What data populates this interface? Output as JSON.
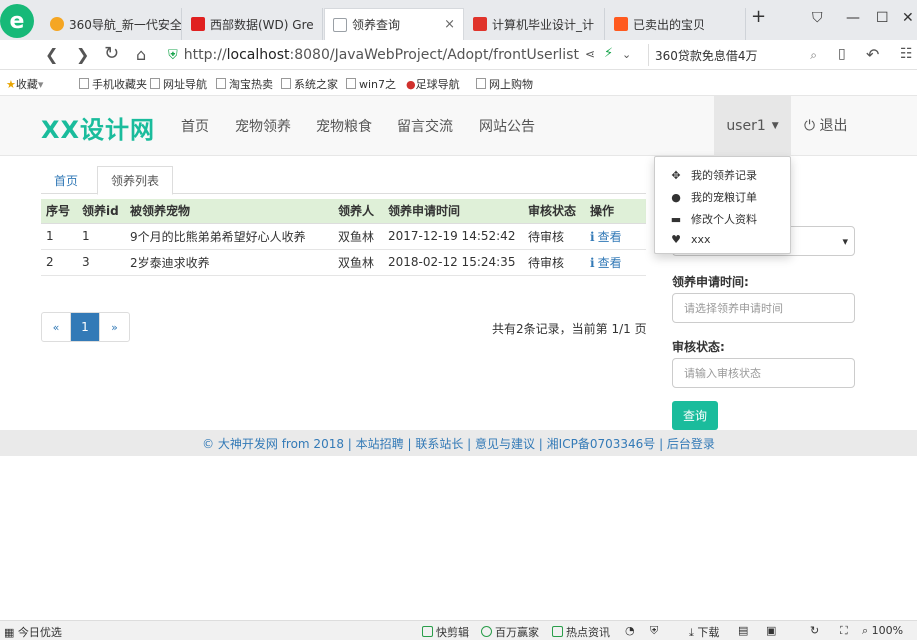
{
  "browser": {
    "tabs": [
      {
        "title": "360导航_新一代安全",
        "fav": "#f5a623"
      },
      {
        "title": "西部数据(WD) Gre",
        "fav": "#e02020"
      },
      {
        "title": "领养查询",
        "fav": "#9aa0a6"
      },
      {
        "title": "计算机毕业设计_计",
        "fav": "#e0342b"
      },
      {
        "title": "已卖出的宝贝",
        "fav": "#ff5a1f"
      }
    ],
    "close_glyph": "×",
    "new_tab_glyph": "+",
    "url_prefix": "http://",
    "url_host": "localhost",
    "url_rest": ":8080/JavaWebProject/Adopt/frontUserlist",
    "search_text": "360贷款免息借4万",
    "bookmarks": [
      "收藏",
      "手机收藏夹",
      "网址导航",
      "淘宝热卖",
      "系统之家",
      "win7之",
      "足球导航",
      "网上购物"
    ]
  },
  "header": {
    "brand": "XX设计网",
    "nav": [
      "首页",
      "宠物领养",
      "宠物粮食",
      "留言交流",
      "网站公告"
    ],
    "user": "user1",
    "logout": "退出"
  },
  "dropdown": {
    "items": [
      {
        "label": "我的领养记录",
        "icon": "move-icon",
        "glyph": "✥"
      },
      {
        "label": "我的宠粮订单",
        "icon": "user-icon",
        "glyph": "●"
      },
      {
        "label": "修改个人资料",
        "icon": "card-icon",
        "glyph": "▬"
      },
      {
        "label": "xxx",
        "icon": "heart-icon",
        "glyph": "♥"
      }
    ]
  },
  "breadcrumb": {
    "home": "首页",
    "current": "领养列表"
  },
  "table": {
    "headers": [
      "序号",
      "领养id",
      "被领养宠物",
      "领养人",
      "领养申请时间",
      "审核状态",
      "操作"
    ],
    "rows": [
      [
        "1",
        "1",
        "9个月的比熊弟弟希望好心人收养",
        "双鱼林",
        "2017-12-19 14:52:42",
        "待审核",
        "查看"
      ],
      [
        "2",
        "3",
        "2岁泰迪求收养",
        "双鱼林",
        "2018-02-12 15:24:35",
        "待审核",
        "查看"
      ]
    ]
  },
  "pagination": {
    "prev": "«",
    "current": "1",
    "next": "»",
    "summary": "共有2条记录，当前第 1/1 页"
  },
  "filter": {
    "time_label": "领养申请时间:",
    "time_placeholder": "请选择领养申请时间",
    "status_label": "审核状态:",
    "status_placeholder": "请输入审核状态",
    "query_button": "查询"
  },
  "footer": {
    "text": "© 大神开发网 from 2018 | 本站招聘 | 联系站长 | 意见与建议 | 湘ICP备0703346号 | 后台登录"
  },
  "statusbar": {
    "left": "今日优选",
    "items": [
      "快剪辑",
      "百万赢家",
      "热点资讯",
      "下载",
      "100%"
    ]
  },
  "colors": {
    "accent": "#1abc9c",
    "link": "#337ab7",
    "table_head": "#dff0d8"
  }
}
